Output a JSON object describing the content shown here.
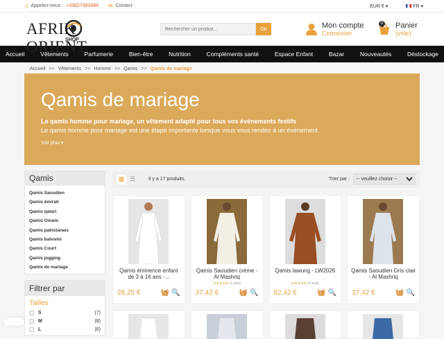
{
  "topbar": {
    "phone_label": "Appelez-nous :",
    "phone_number": "+33627393384",
    "contact": "Contact",
    "currency": "EUR €",
    "language": "FR"
  },
  "header": {
    "logo_text": "AFRIK ORIENT",
    "logo_sub": "SHOP",
    "search_placeholder": "Rechercher un produit...",
    "search_button": "OK",
    "account_title": "Mon compte",
    "account_sub": "Connexion",
    "cart_title": "Panier",
    "cart_sub": "(vide)",
    "cart_count": "0"
  },
  "nav": [
    "Accueil",
    "Vêtements",
    "Parfumerie",
    "Bien-être",
    "Nutrition",
    "Compléments santé",
    "Espace Enfant",
    "Bazar",
    "Nouveautés",
    "Déstockage"
  ],
  "breadcrumb": [
    "Accueil",
    ">>",
    "Vêtements",
    ">>",
    "Homme",
    ">>",
    "Qamis",
    ">>",
    "Qamis de mariage"
  ],
  "banner": {
    "title": "Qamis de mariage",
    "subtitle": "Le qamis homme pour mariage, un vêtement adapté pour tous vos événements festifs",
    "description": "Le qamis homme pour mariage est une étape importante lorsque vous vous rendez à un événement.",
    "more": "Voir plus"
  },
  "sidebar": {
    "title": "Qamis",
    "items": [
      "Qamis Saoudien",
      "Qamis émirati",
      "Qamis qatari",
      "Qamis Omani",
      "Qamis pakistanais",
      "Qamis bahreini",
      "Qamis Court",
      "Qamis jogging",
      "Qamis de mariage"
    ]
  },
  "filter": {
    "title": "Filtrer par",
    "section": "Tailles",
    "sizes": [
      {
        "label": "S",
        "count": "(7)"
      },
      {
        "label": "M",
        "count": "(8)"
      },
      {
        "label": "L",
        "count": "(6)"
      }
    ]
  },
  "toolbar": {
    "count": "Il y a 17 produits.",
    "sort_label": "Trier par :",
    "sort_value": "-- veuillez choisir --"
  },
  "products": [
    {
      "name": "Qamis éminence enfant de 3 à 16 ans -...",
      "price": "28,25 €",
      "stars": "",
      "reviews": "",
      "color": "#ffffff",
      "bg": "#e6e6e6"
    },
    {
      "name": "Qamis Saoudien crème - Al Mashriq",
      "price": "37,42 €",
      "stars": "★★★★★",
      "reviews": "(1 avis)",
      "color": "#f3efe4",
      "bg": "#8a6a3a"
    },
    {
      "name": "Qamis lawung - LW2026",
      "price": "62,42 €",
      "stars": "★★★★★",
      "reviews": "(2 avis)",
      "color": "#9a4e24",
      "bg": "#dcdcdc"
    },
    {
      "name": "Qamis Saoudien Gris clair - Al Mashriq",
      "price": "37,42 €",
      "stars": "",
      "reviews": "",
      "color": "#dde3ea",
      "bg": "#9c7a50"
    }
  ],
  "colors": {
    "accent": "#e9a13b",
    "banner": "#dba95a",
    "nav": "#111111"
  }
}
